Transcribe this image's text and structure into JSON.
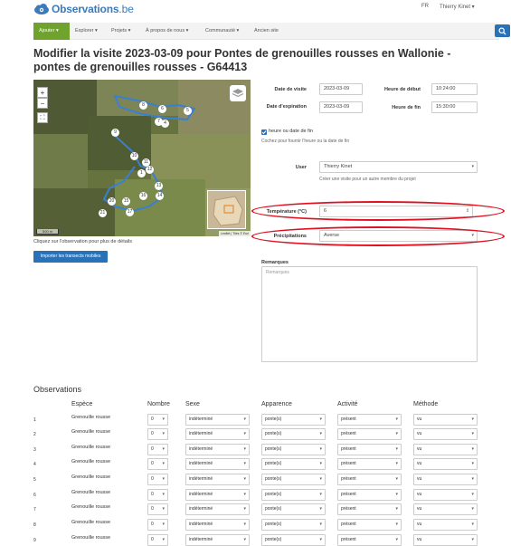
{
  "brand": {
    "name_bold": "Observations",
    "name_suffix": ".be"
  },
  "topbar": {
    "lang": "FR",
    "user": "Thierry Kinet ▾"
  },
  "nav": {
    "items": [
      "Ajouter ▾",
      "Explorer ▾",
      "Projets ▾",
      "À propos de nous ▾",
      "Communauté ▾",
      "Ancien site"
    ]
  },
  "page": {
    "title": "Modifier la visite 2023-03-09 pour Pontes de grenouilles rousses en Wallonie - pontes de grenouilles rousses - G64413"
  },
  "map": {
    "caption": "Cliquez sur l'observation pour plus de détails",
    "scale": "500 m",
    "attribution": "Leaflet | Tiles © Esri",
    "zoom_in": "+",
    "zoom_out": "−",
    "fullscreen": "⛶",
    "markers": [
      "8",
      "5",
      "6",
      "7",
      "4",
      "9",
      "10",
      "11",
      "12",
      "1",
      "13",
      "14",
      "15",
      "16",
      "20",
      "17",
      "21"
    ]
  },
  "import_button": "Importer les transects mobiles",
  "form": {
    "date_label": "Date de visite",
    "date_value": "2023-03-09",
    "start_label": "Heure de début",
    "start_value": "10:24:00",
    "exp_label": "Date d'expiration",
    "exp_value": "2023-03-09",
    "end_label": "Heure de fin",
    "end_value": "15:30:00",
    "check_label": "heure ou date de fin",
    "check_help": "Cochez pour fournir l'heure ou la date de fin",
    "user_label": "User",
    "user_value": "Thierry Kinet",
    "user_help": "Créer une visite pour un autre membre du projet",
    "temp_label": "Température (°C)",
    "temp_value": "6",
    "precip_label": "Précipitations",
    "precip_value": "Averse",
    "remarks_label": "Remarques",
    "remarks_placeholder": "Remarques"
  },
  "observations": {
    "title": "Observations",
    "headers": [
      "Espèce",
      "Nombre",
      "Sexe",
      "Apparence",
      "Activité",
      "Méthode"
    ],
    "rows": [
      {
        "n": "1",
        "species": "Grenouille rousse",
        "count": "0",
        "sex": "indéterminé",
        "app": "ponte(s)",
        "act": "présent",
        "meth": "vu"
      },
      {
        "n": "2",
        "species": "Grenouille rousse",
        "count": "0",
        "sex": "indéterminé",
        "app": "ponte(s)",
        "act": "présent",
        "meth": "vu"
      },
      {
        "n": "3",
        "species": "Grenouille rousse",
        "count": "0",
        "sex": "indéterminé",
        "app": "ponte(s)",
        "act": "présent",
        "meth": "vu"
      },
      {
        "n": "4",
        "species": "Grenouille rousse",
        "count": "0",
        "sex": "indéterminé",
        "app": "ponte(s)",
        "act": "présent",
        "meth": "vu"
      },
      {
        "n": "5",
        "species": "Grenouille rousse",
        "count": "0",
        "sex": "indéterminé",
        "app": "ponte(s)",
        "act": "présent",
        "meth": "vu"
      },
      {
        "n": "6",
        "species": "Grenouille rousse",
        "count": "0",
        "sex": "indéterminé",
        "app": "ponte(s)",
        "act": "présent",
        "meth": "vu"
      },
      {
        "n": "7",
        "species": "Grenouille rousse",
        "count": "0",
        "sex": "indéterminé",
        "app": "ponte(s)",
        "act": "présent",
        "meth": "vu"
      },
      {
        "n": "8",
        "species": "Grenouille rousse",
        "count": "0",
        "sex": "indéterminé",
        "app": "ponte(s)",
        "act": "présent",
        "meth": "vu"
      },
      {
        "n": "9",
        "species": "Grenouille rousse",
        "count": "0",
        "sex": "indéterminé",
        "app": "ponte(s)",
        "act": "présent",
        "meth": "vu"
      }
    ]
  },
  "colors": {
    "brand": "#3d7ab8",
    "nav_active": "#6fa32e",
    "primary": "#2a72b8",
    "highlight": "#e01020"
  }
}
